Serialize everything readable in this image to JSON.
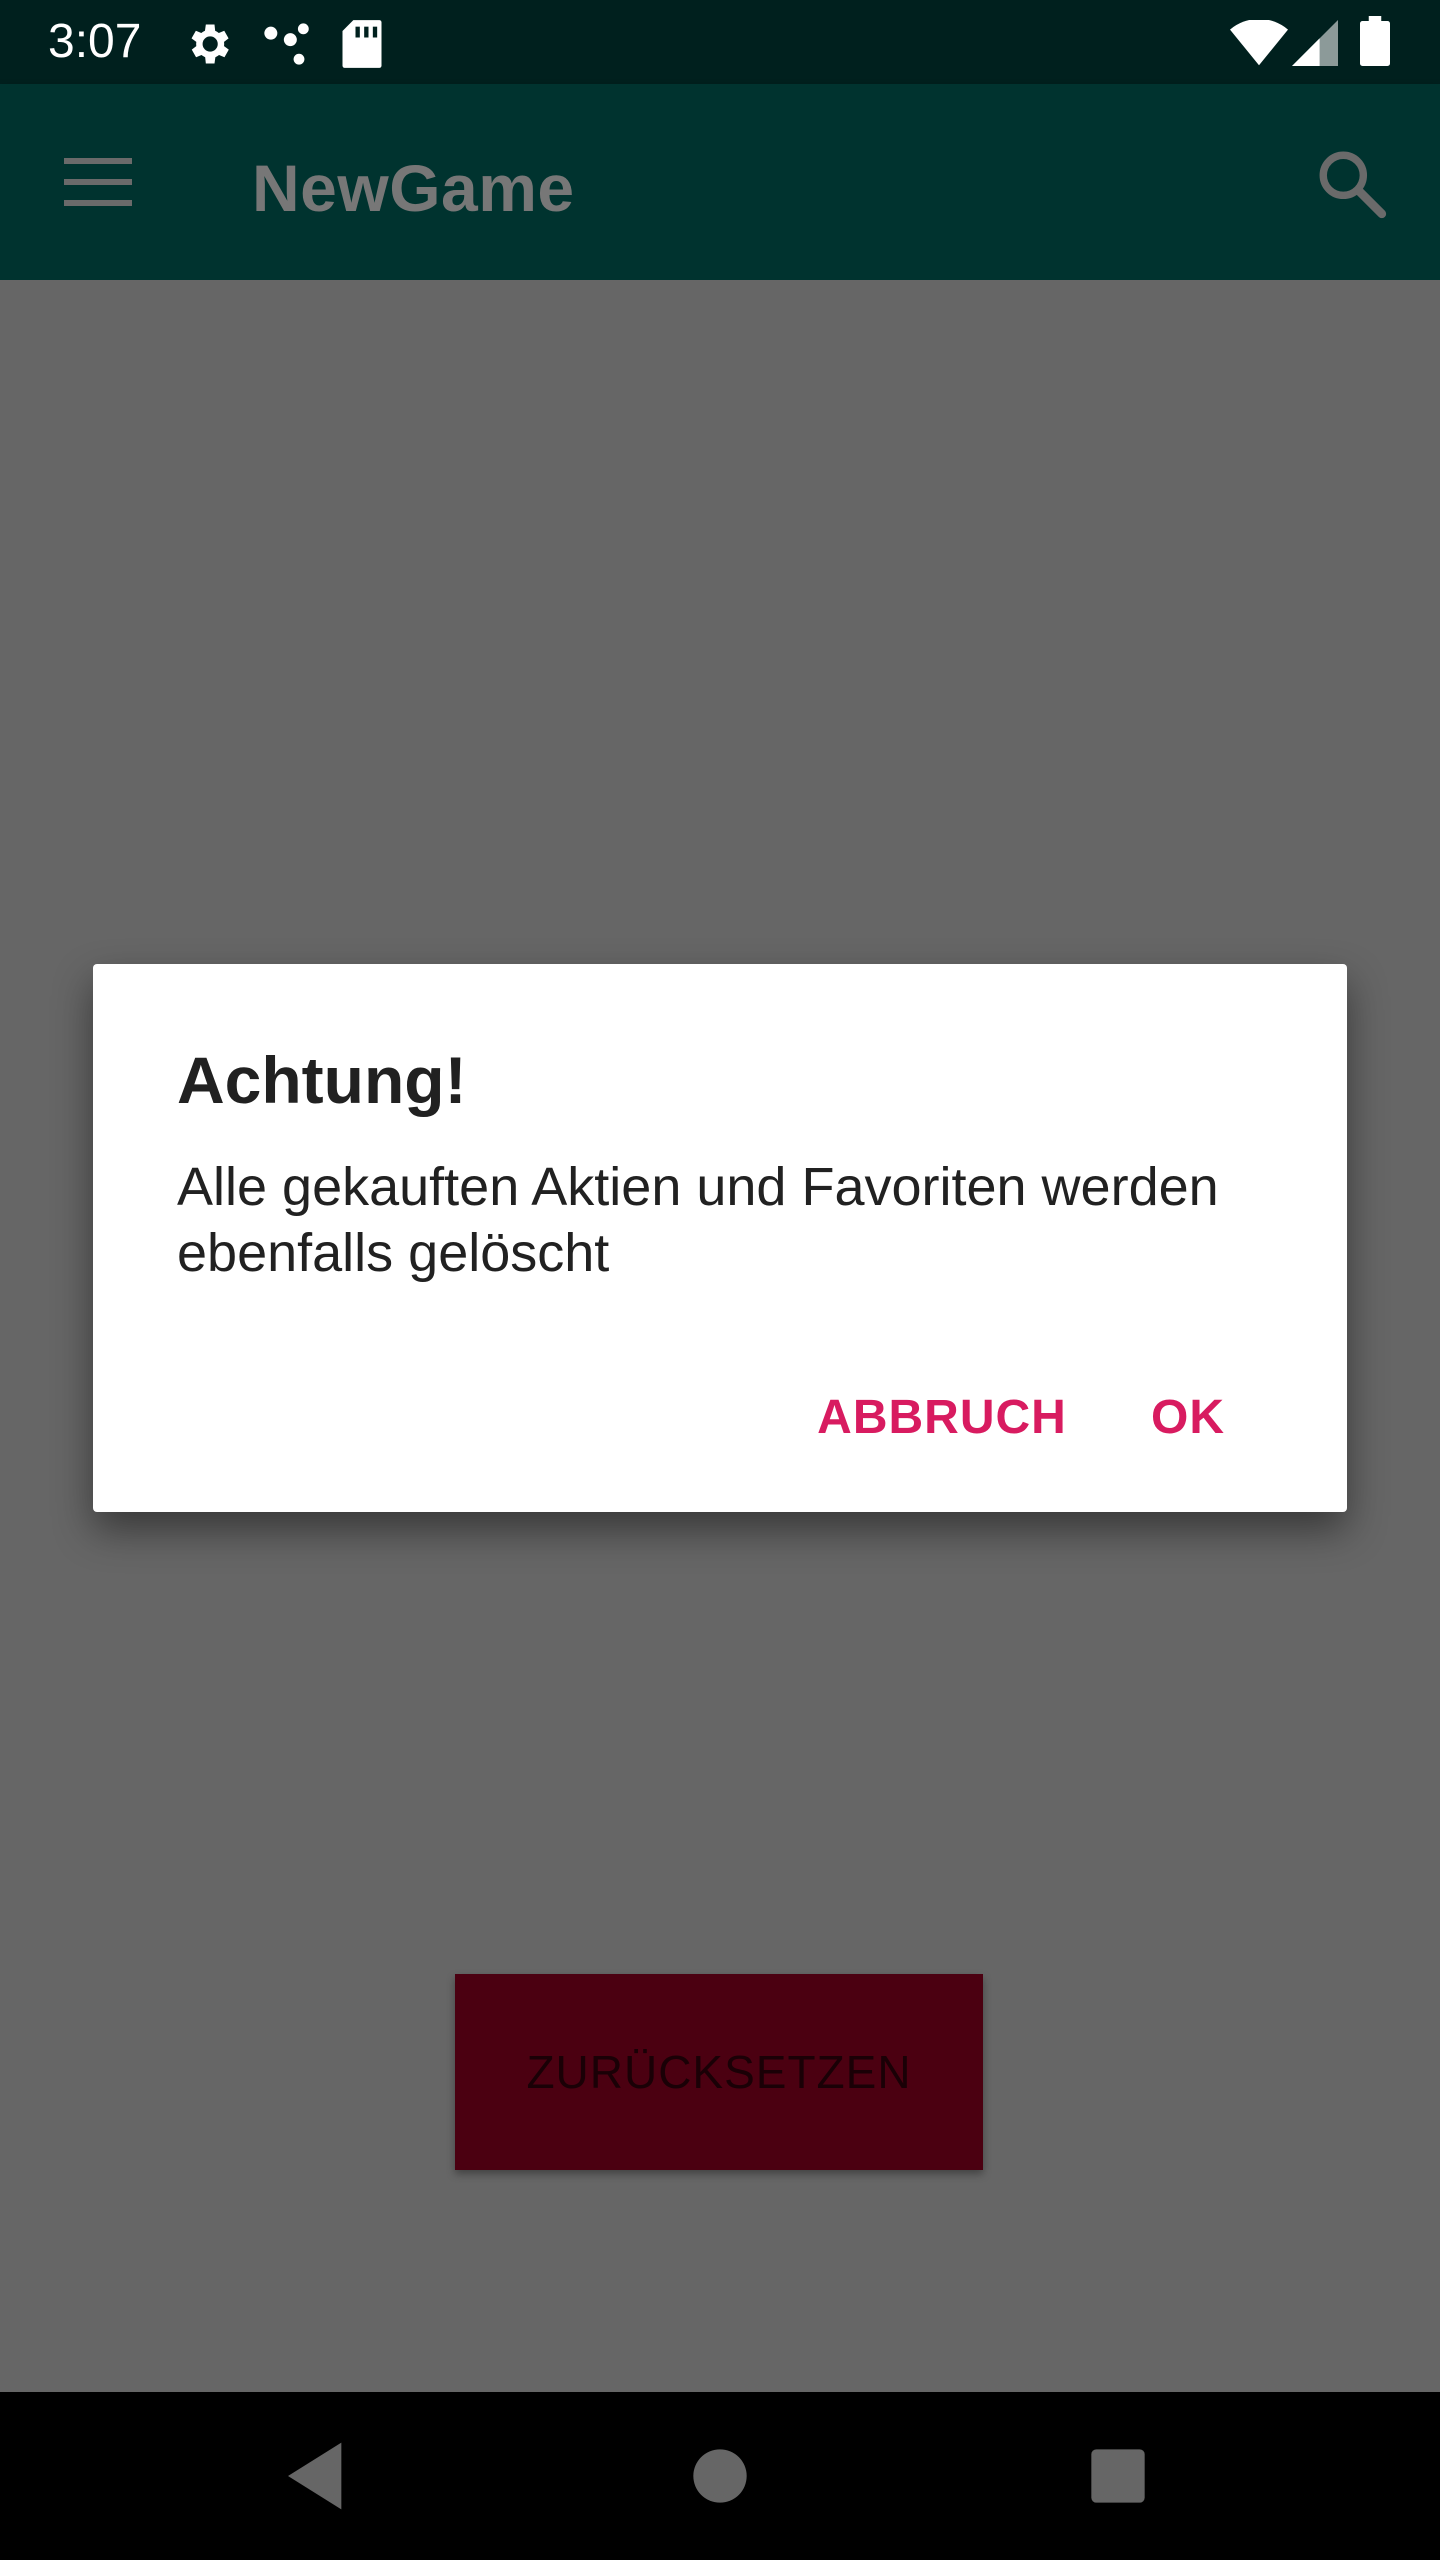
{
  "status_bar": {
    "time": "3:07",
    "icons": [
      "settings-icon",
      "dots-icon",
      "sd-card-icon",
      "wifi-icon",
      "signal-icon",
      "battery-icon"
    ]
  },
  "app_bar": {
    "title": "NewGame",
    "menu_icon": "menu-icon",
    "search_icon": "search-icon"
  },
  "content": {
    "reset_button_label": "ZURÜCKSETZEN"
  },
  "dialog": {
    "title": "Achtung!",
    "message": "Alle gekauften Aktien und Favoriten werden ebenfalls gelöscht",
    "cancel_label": "ABBRUCH",
    "ok_label": "OK"
  },
  "nav_bar": {
    "icons": [
      "back-icon",
      "home-icon",
      "recents-icon"
    ]
  },
  "colors": {
    "status_bar": "#00201e",
    "app_bar": "#00332f",
    "scrim_background": "#666666",
    "reset_button": "#4b0011",
    "dialog_button_text": "#d81b60"
  }
}
